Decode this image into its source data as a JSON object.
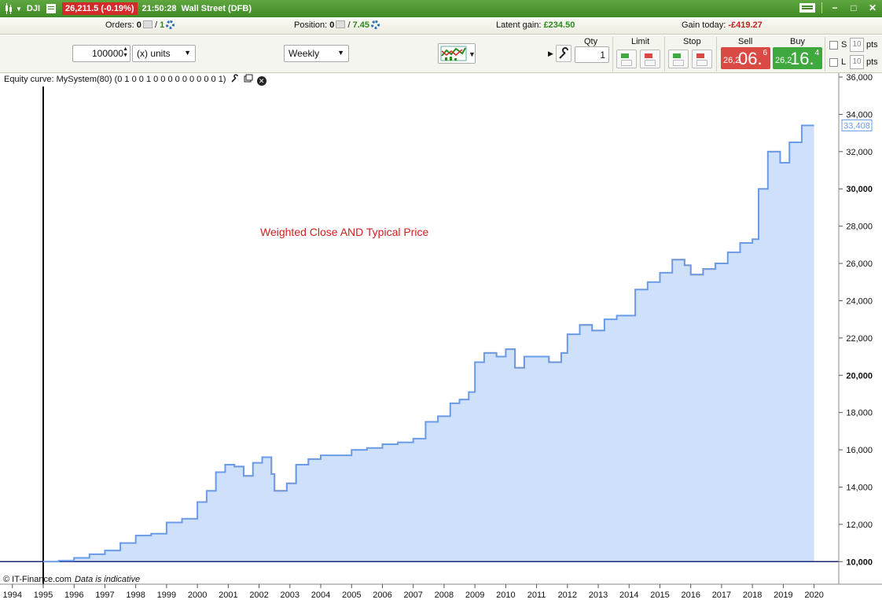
{
  "titlebar": {
    "symbol": "DJI",
    "price_change": "26,211.5 (-0.19%)",
    "time": "21:50:28",
    "instrument": "Wall Street (DFB)"
  },
  "infobar": {
    "orders_label": "Orders:",
    "orders_value": "0",
    "orders_slash": "/",
    "orders_count": "1",
    "position_label": "Position:",
    "position_value": "0",
    "position_slash": "/",
    "position_amount": "7.45",
    "latent_label": "Latent gain:",
    "latent_value": "£234.50",
    "gain_today_label": "Gain today:",
    "gain_today_value": "-£419.27"
  },
  "toolbar": {
    "quantity_value": "100000",
    "units_select": "(x) units",
    "timeframe_select": "Weekly"
  },
  "order_panel": {
    "qty_label": "Qty",
    "qty_value": "1",
    "limit_label": "Limit",
    "stop_label": "Stop",
    "sell_label": "Sell",
    "buy_label": "Buy",
    "sell_small": "26,2",
    "sell_big": "06.",
    "sell_sup": "6",
    "buy_small": "26,2",
    "buy_big": "16.",
    "buy_sup": "4",
    "s_label": "S",
    "l_label": "L",
    "s_pts": "10",
    "l_pts": "10",
    "pts_label": "pts"
  },
  "chart": {
    "legend_text": "Equity curve: MySystem(80) (0 1 0 0 1 0 0 0 0 0 0 0 0 0 1)",
    "annotation": "Weighted Close AND Typical Price",
    "copyright": "© IT-Finance.com",
    "disclaimer": "Data is indicative",
    "colors": {
      "fill": "#cfe0fb",
      "line": "#6a9be8",
      "drawdown": "#f5a33b",
      "baseline": "#1a2a7a",
      "annotation": "#d42020"
    }
  },
  "chart_data": {
    "type": "area",
    "title": "",
    "xlabel": "",
    "ylabel": "",
    "ylim": [
      9000,
      36000
    ],
    "y_ticks": [
      "36,000",
      "34,000",
      "32,000",
      "30,000",
      "28,000",
      "26,000",
      "24,000",
      "22,000",
      "20,000",
      "18,000",
      "16,000",
      "14,000",
      "12,000",
      "10,000"
    ],
    "y_tick_values": [
      36000,
      34000,
      32000,
      30000,
      28000,
      26000,
      24000,
      22000,
      20000,
      18000,
      16000,
      14000,
      12000,
      10000
    ],
    "major_ticks": [
      30000,
      20000,
      10000
    ],
    "last_value_label": "33,408",
    "x_ticks": [
      "1994",
      "1995",
      "1996",
      "1997",
      "1998",
      "1999",
      "2000",
      "2001",
      "2002",
      "2003",
      "2004",
      "2005",
      "2006",
      "2007",
      "2008",
      "2009",
      "2010",
      "2011",
      "2012",
      "2013",
      "2014",
      "2015",
      "2016",
      "2017",
      "2018",
      "2019",
      "2020"
    ],
    "x_range": [
      1993.7,
      2020.8
    ],
    "cursor_year": 1995.0,
    "baseline": 10000,
    "series": [
      {
        "x": [
          1995.0,
          1995.5,
          1996.0,
          1996.5,
          1997.0,
          1997.5,
          1998.0,
          1998.5,
          1999.0,
          1999.5,
          2000.0,
          2000.3,
          2000.6,
          2000.9,
          2001.2,
          2001.5,
          2001.8,
          2002.1,
          2002.4,
          2002.5,
          2002.9,
          2003.2,
          2003.6,
          2004.0,
          2004.5,
          2005.0,
          2005.5,
          2006.0,
          2006.5,
          2007.0,
          2007.4,
          2007.8,
          2008.2,
          2008.5,
          2008.8,
          2009.0,
          2009.3,
          2009.7,
          2010.0,
          2010.3,
          2010.6,
          2011.0,
          2011.4,
          2011.8,
          2012.0,
          2012.4,
          2012.8,
          2013.2,
          2013.6,
          2013.9,
          2014.2,
          2014.6,
          2015.0,
          2015.4,
          2015.8,
          2016.0,
          2016.4,
          2016.8,
          2017.2,
          2017.6,
          2018.0,
          2018.2,
          2018.5,
          2018.9,
          2019.2,
          2019.6
        ],
        "values": [
          10000,
          10050,
          10200,
          10400,
          10600,
          11000,
          11400,
          11500,
          12100,
          12300,
          13200,
          13800,
          14800,
          15200,
          15100,
          14600,
          15300,
          15600,
          14700,
          13800,
          14200,
          15200,
          15500,
          15700,
          15700,
          16000,
          16100,
          16300,
          16400,
          16600,
          17500,
          17800,
          18500,
          18700,
          19100,
          20700,
          21200,
          21000,
          21400,
          20400,
          21000,
          21000,
          20700,
          21200,
          22200,
          22700,
          22400,
          23000,
          23200,
          23200,
          24600,
          25000,
          25500,
          26200,
          25900,
          25400,
          25700,
          26000,
          26600,
          27100,
          27300,
          30000,
          32000,
          31400,
          32500,
          33408
        ]
      }
    ]
  }
}
